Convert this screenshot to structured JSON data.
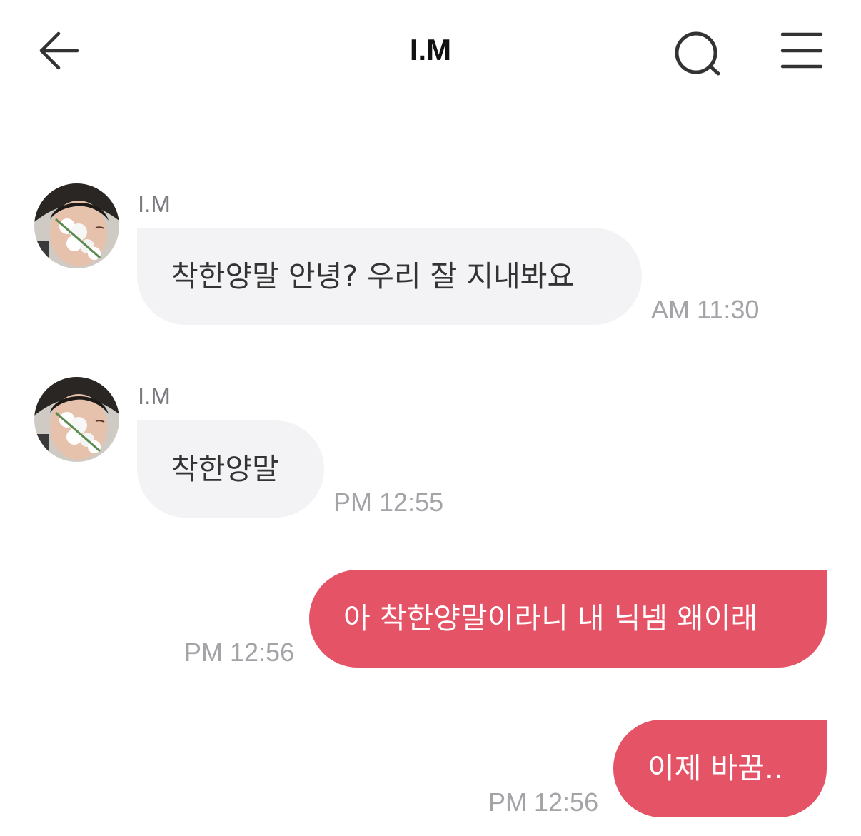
{
  "header": {
    "title": "I.M",
    "back_icon": "arrow-left-icon",
    "search_icon": "search-icon",
    "menu_icon": "hamburger-menu-icon"
  },
  "messages": [
    {
      "direction": "incoming",
      "sender": "I.M",
      "text": "착한양말 안녕? 우리 잘 지내봐요",
      "time": "AM 11:30"
    },
    {
      "direction": "incoming",
      "sender": "I.M",
      "text": "착한양말",
      "time": "PM 12:55"
    },
    {
      "direction": "outgoing",
      "text": "아 착한양말이라니 내 닉넴 왜이래",
      "time": "PM 12:56"
    },
    {
      "direction": "outgoing",
      "text": "이제 바꿈..",
      "time": "PM 12:56"
    }
  ],
  "colors": {
    "incoming_bubble": "#f3f3f5",
    "outgoing_bubble": "#e55466",
    "timestamp": "#a3a3a8"
  }
}
